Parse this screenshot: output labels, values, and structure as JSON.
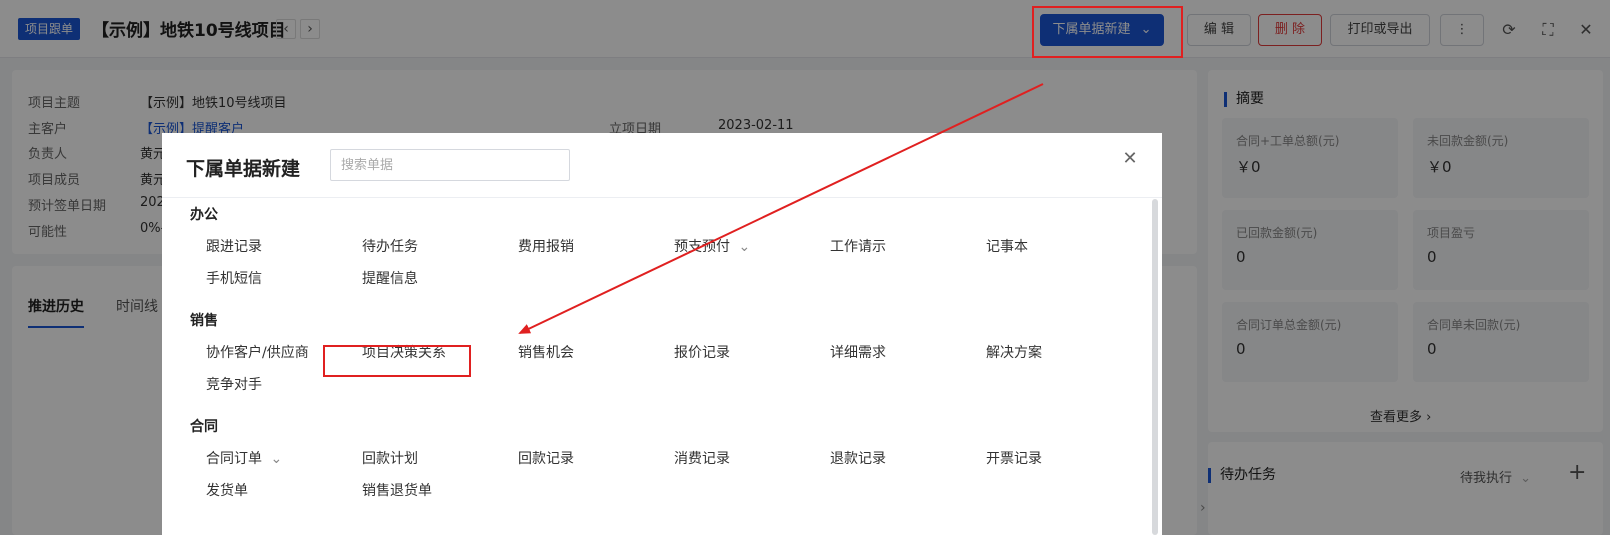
{
  "header": {
    "tag": "项目跟单",
    "title": "【示例】地铁10号线项目",
    "prev": "‹",
    "next": "›",
    "new_btn": "下属单据新建",
    "edit_btn": "编 辑",
    "delete_btn": "删 除",
    "print_btn": "打印或导出",
    "more_btn": "⋮"
  },
  "info": {
    "rows": [
      {
        "label": "项目主题",
        "value": "【示例】地铁10号线项目"
      },
      {
        "label": "主客户",
        "value": "【示例】提醒客户"
      },
      {
        "label": "负责人",
        "value": "黄元"
      },
      {
        "label": "项目成员",
        "value": "黄元"
      },
      {
        "label": "预计签单日期",
        "value": "202"
      },
      {
        "label": "可能性",
        "value": "0%-"
      }
    ],
    "date_label": "立项日期",
    "date_value": "2023-02-11"
  },
  "tabs": [
    "推进历史",
    "时间线"
  ],
  "summary": {
    "title": "摘要",
    "items": [
      {
        "label": "合同+工单总额(元)",
        "value": "￥0"
      },
      {
        "label": "未回款金额(元)",
        "value": "￥0"
      },
      {
        "label": "已回款金额(元)",
        "value": "0"
      },
      {
        "label": "项目盈亏",
        "value": "0"
      },
      {
        "label": "合同订单总金额(元)",
        "value": "0"
      },
      {
        "label": "合同单未回款(元)",
        "value": "0"
      }
    ],
    "more": "查看更多"
  },
  "todo": {
    "title": "待办任务",
    "filter": "待我执行"
  },
  "modal": {
    "title": "下属单据新建",
    "search_placeholder": "搜索单据",
    "groups": [
      {
        "title": "办公",
        "items": [
          "跟进记录",
          "待办任务",
          "费用报销",
          "预支预付",
          "工作请示",
          "记事本",
          "手机短信",
          "提醒信息"
        ]
      },
      {
        "title": "销售",
        "items": [
          "协作客户/供应商",
          "项目决策关系",
          "销售机会",
          "报价记录",
          "详细需求",
          "解决方案",
          "竞争对手"
        ]
      },
      {
        "title": "合同",
        "items": [
          "合同订单",
          "回款计划",
          "回款记录",
          "消费记录",
          "退款记录",
          "开票记录",
          "发货单",
          "销售退货单"
        ]
      }
    ]
  },
  "colors": {
    "accent": "#1a56d6",
    "annotation": "#e02020"
  }
}
